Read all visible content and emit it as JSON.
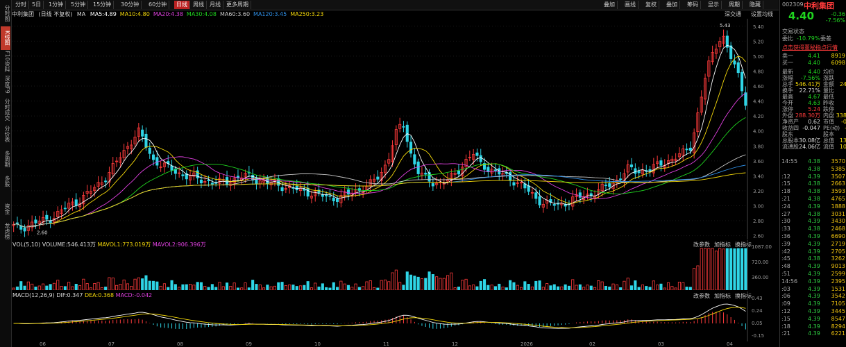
{
  "left_nav": [
    {
      "label": "分时图",
      "active": false
    },
    {
      "label": "K线图",
      "active": true
    },
    {
      "label": "F10资料",
      "active": false
    },
    {
      "label": "深度F9",
      "active": false
    },
    {
      "label": "分时成交",
      "active": false
    },
    {
      "label": "分价表",
      "active": false
    },
    {
      "label": "多周期",
      "active": false
    },
    {
      "label": "多股",
      "active": false
    },
    {
      "label": "资金",
      "active": false
    },
    {
      "label": "龙虎榜",
      "active": false
    }
  ],
  "toolbar": {
    "periods": [
      "分时",
      "5日",
      "1分钟",
      "5分钟",
      "15分钟",
      "30分钟",
      "60分钟",
      "日线",
      "周线",
      "月线",
      "更多周期"
    ],
    "active_period": "日线",
    "right_buttons": [
      "叠加",
      "画线",
      "复权",
      "叠加",
      "筹码",
      "显示",
      "周期",
      "隐藏"
    ]
  },
  "chart_header": {
    "name": "中利集团",
    "setting": "(日线 不复权)",
    "ma_label": "MA",
    "ma": [
      {
        "text": "MA5:4.89",
        "color": "#ffffff"
      },
      {
        "text": "MA10:4.80",
        "color": "#f5d90a"
      },
      {
        "text": "MA20:4.38",
        "color": "#e040e0"
      },
      {
        "text": "MA30:4.08",
        "color": "#1fd41f"
      },
      {
        "text": "MA60:3.60",
        "color": "#c8c8c8"
      },
      {
        "text": "MA120:3.45",
        "color": "#2f8fe6"
      },
      {
        "text": "MA250:3.23",
        "color": "#f5d90a"
      }
    ],
    "depth_label": "深交通",
    "setting_button": "设置均线"
  },
  "volume_header": {
    "title": "VOL(5,10)",
    "volume": "VOLUME:546.413万",
    "mavol1": "MAVOL1:773.019万",
    "mavol2": "MAVOL2:906.396万",
    "buttons": [
      "改参数",
      "加指标",
      "换指标"
    ]
  },
  "macd_header": {
    "title": "MACD(12,26,9)",
    "dif": "DIF:0.347",
    "dea": "DEA:0.368",
    "macd": "MACD:-0.042",
    "buttons": [
      "改参数",
      "加指标",
      "换指标"
    ]
  },
  "price_axis": [
    "5.40",
    "5.20",
    "5.00",
    "4.80",
    "4.60",
    "4.40",
    "4.20",
    "4.00",
    "3.80",
    "3.60",
    "3.40",
    "3.20",
    "3.00",
    "2.80",
    "2.60"
  ],
  "volume_axis": [
    "1087.00",
    "720.00",
    "360.00"
  ],
  "macd_axis": [
    "0.43",
    "0.24",
    "0.05",
    "-0.15"
  ],
  "time_axis": [
    "06",
    "07",
    "08",
    "09",
    "10",
    "11",
    "12",
    "2026",
    "02",
    "03",
    "04"
  ],
  "annotations": {
    "high": "5.43",
    "low": "2.60"
  },
  "right_panel": {
    "code": "002309",
    "name": "中利集团",
    "price": "4.40",
    "change": "-0.36",
    "change_pct": "-7.56%",
    "tab_left": "交易状态",
    "weibi_label": "委比",
    "weibi": "-10.79%",
    "weicha_label": "委差",
    "link": "点击获得董秘指点行情",
    "sell1_label": "卖一",
    "sell1_price": "4.41",
    "sell1_vol": "8919",
    "buy1_label": "买一",
    "buy1_price": "4.40",
    "buy1_vol": "6098",
    "stats": [
      {
        "l": "最新",
        "v": "4.40",
        "l2": "均价",
        "v2": "",
        "c": "green"
      },
      {
        "l": "涨幅",
        "v": "-7.56%",
        "l2": "涨跌",
        "v2": "",
        "c": "green"
      },
      {
        "l": "总手",
        "v": "546.41万",
        "l2": "金额",
        "v2": "24",
        "c": "yellow"
      },
      {
        "l": "换手",
        "v": "22.71%",
        "l2": "量比",
        "v2": "",
        "c": "white"
      },
      {
        "l": "最高",
        "v": "4.67",
        "l2": "最低",
        "v2": "",
        "c": "green"
      },
      {
        "l": "今开",
        "v": "4.63",
        "l2": "昨收",
        "v2": "",
        "c": "green"
      },
      {
        "l": "涨停",
        "v": "5.24",
        "l2": "跌停",
        "v2": "",
        "c": "red"
      },
      {
        "l": "外盘",
        "v": "288.30万",
        "l2": "内盘",
        "v2": "338",
        "c": "red"
      },
      {
        "l": "净资产",
        "v": "0.62",
        "l2": "市值",
        "v2": "-0",
        "c": "white"
      },
      {
        "l": "收益四",
        "v": "-0.047",
        "l2": "PE(动)",
        "v2": "-",
        "c": "white"
      },
      {
        "l": "股东",
        "v": "",
        "l2": "股本",
        "v2": "",
        "c": "white"
      },
      {
        "l": "总股本",
        "v": "30.08亿",
        "l2": "总值",
        "v2": "13",
        "c": "white"
      },
      {
        "l": "流通股",
        "v": "24.06亿",
        "l2": "流值",
        "v2": "10",
        "c": "white"
      }
    ],
    "ticks_time_header": "14:55",
    "ticks": [
      {
        "t": "14:55",
        "p": "4.38",
        "v": "3570"
      },
      {
        "t": "",
        "p": "4.38",
        "v": "5385"
      },
      {
        "t": ":12",
        "p": "4.39",
        "v": "3507"
      },
      {
        "t": ":15",
        "p": "4.38",
        "v": "2663"
      },
      {
        "t": ":18",
        "p": "4.38",
        "v": "3593"
      },
      {
        "t": ":21",
        "p": "4.38",
        "v": "4765"
      },
      {
        "t": ":24",
        "p": "4.39",
        "v": "1888"
      },
      {
        "t": ":27",
        "p": "4.38",
        "v": "3031"
      },
      {
        "t": ":30",
        "p": "4.39",
        "v": "3430"
      },
      {
        "t": ":33",
        "p": "4.38",
        "v": "2468"
      },
      {
        "t": ":36",
        "p": "4.39",
        "v": "6690"
      },
      {
        "t": ":39",
        "p": "4.39",
        "v": "2719"
      },
      {
        "t": ":42",
        "p": "4.39",
        "v": "2705"
      },
      {
        "t": ":45",
        "p": "4.38",
        "v": "3262"
      },
      {
        "t": ":48",
        "p": "4.39",
        "v": "9013"
      },
      {
        "t": ":51",
        "p": "4.39",
        "v": "2599"
      },
      {
        "t": "14:56",
        "p": "4.39",
        "v": "2395"
      },
      {
        "t": ":03",
        "p": "4.39",
        "v": "1531"
      },
      {
        "t": ":06",
        "p": "4.39",
        "v": "3542"
      },
      {
        "t": ":09",
        "p": "4.39",
        "v": "7105"
      },
      {
        "t": ":12",
        "p": "4.39",
        "v": "3445"
      },
      {
        "t": ":15",
        "p": "4.39",
        "v": "8547"
      },
      {
        "t": ":18",
        "p": "4.39",
        "v": "8294"
      },
      {
        "t": ":21",
        "p": "4.39",
        "v": "6221"
      }
    ]
  },
  "chart_data": {
    "type": "candlestick",
    "title": "中利集团 (日线 不复权)",
    "ylim": [
      2.55,
      5.5
    ],
    "note_high": "5.43",
    "note_low": "2.60",
    "seed_closes": [
      2.72,
      2.7,
      2.75,
      2.78,
      2.8,
      2.85,
      2.92,
      3.0,
      3.05,
      3.12,
      3.2,
      3.3,
      3.4,
      3.55,
      3.7,
      3.85,
      4.0,
      3.8,
      3.6,
      3.55,
      3.5,
      3.45,
      3.4,
      3.38,
      3.35,
      3.33,
      3.3,
      3.32,
      3.35,
      3.38,
      3.4,
      3.36,
      3.32,
      3.3,
      3.28,
      3.25,
      3.22,
      3.2,
      3.18,
      3.15,
      3.12,
      3.1,
      3.12,
      3.15,
      3.2,
      3.25,
      3.3,
      3.4,
      3.6,
      3.95,
      4.1,
      3.7,
      3.45,
      3.35,
      3.3,
      3.32,
      3.35,
      3.45,
      3.6,
      3.7,
      3.55,
      3.5,
      3.45,
      3.4,
      3.35,
      3.3,
      3.2,
      3.1,
      3.05,
      3.02,
      3.0,
      3.05,
      3.1,
      3.12,
      3.15,
      3.2,
      3.25,
      3.3,
      3.4,
      3.5,
      3.45,
      3.48,
      3.5,
      3.55,
      3.6,
      3.65,
      3.7,
      3.8,
      4.3,
      4.8,
      5.1,
      5.3,
      5.0,
      4.76,
      4.4
    ]
  }
}
